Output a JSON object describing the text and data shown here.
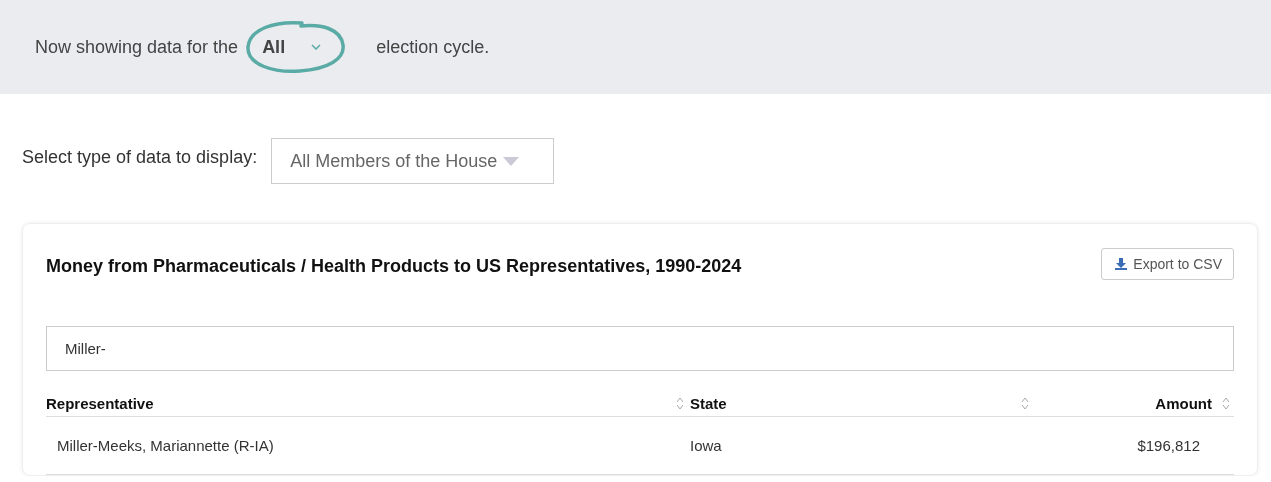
{
  "banner": {
    "text_before": "Now showing data for the",
    "cycle_select": {
      "value": "All"
    },
    "text_after": "election cycle."
  },
  "data_type": {
    "label": "Select type of data to display:",
    "select": {
      "value": "All Members of the House"
    }
  },
  "card": {
    "title": "Money from Pharmaceuticals / Health Products to US Representatives, 1990-2024",
    "export_button": "Export to CSV",
    "search": {
      "value": "Miller-"
    },
    "table": {
      "columns": [
        {
          "label": "Representative",
          "kind": "text"
        },
        {
          "label": "State",
          "kind": "text"
        },
        {
          "label": "Amount",
          "kind": "money"
        }
      ],
      "rows": [
        {
          "cells": [
            "Miller-Meeks, Mariannette (R-IA)",
            "Iowa",
            "$196,812"
          ]
        }
      ]
    }
  }
}
